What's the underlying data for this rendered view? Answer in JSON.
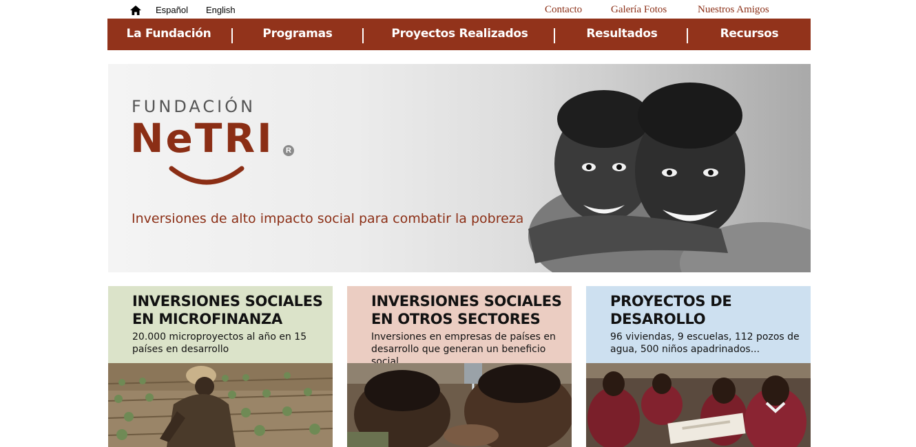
{
  "topbar": {
    "home_icon": "home-icon",
    "languages": [
      "Español",
      "English"
    ],
    "links": [
      "Contacto",
      "Galería Fotos",
      "Nuestros Amigos"
    ]
  },
  "nav": {
    "items": [
      "La Fundación",
      "Programas",
      "Proyectos Realizados",
      "Resultados",
      "Recursos"
    ]
  },
  "hero": {
    "brand_top": "FUNDACIÓN",
    "brand_main": "NeTRI",
    "registered": "R",
    "tagline": "Inversiones de alto impacto social para combatir la pobreza"
  },
  "cards": [
    {
      "title_line1": "INVERSIONES SOCIALES",
      "title_line2": "EN MICROFINANZA",
      "description": "20.000 microproyectos al año en 15 países en desarrollo",
      "color": "#dbe3c9"
    },
    {
      "title_line1": "INVERSIONES SOCIALES",
      "title_line2": "EN OTROS SECTORES",
      "description": "Inversiones en empresas de países en desarrollo que generan un beneficio social",
      "color": "#ebcdc2"
    },
    {
      "title_line1": "PROYECTOS DE",
      "title_line2": "DESAROLLO",
      "description": "96 viviendas, 9 escuelas, 112 pozos de agua, 500 niños apadrinados...",
      "color": "#cde0f0"
    }
  ],
  "colors": {
    "brand": "#92331b",
    "link": "#8b2e15"
  }
}
